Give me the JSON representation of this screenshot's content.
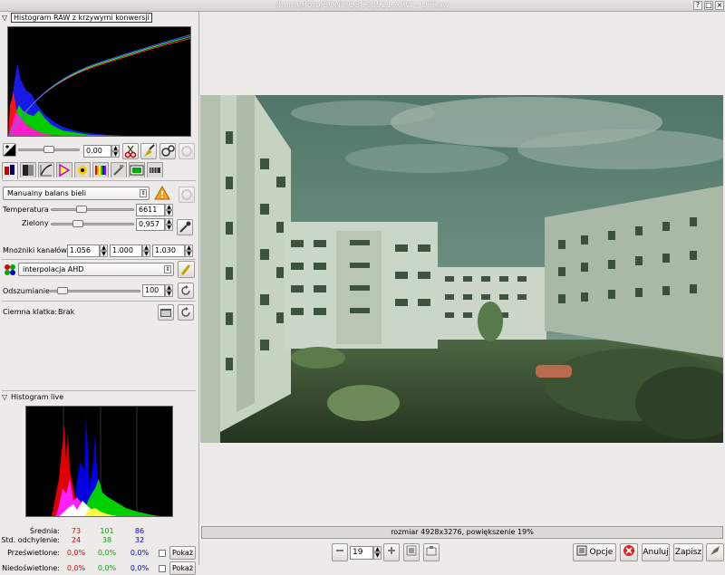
{
  "window": {
    "title": "/home/foto/SONY/DSC00521.ARW - UFRaw",
    "buttons": [
      "?",
      "□",
      "×"
    ]
  },
  "raw_histogram": {
    "title": "Histogram RAW z krzywymi konwersji"
  },
  "exposure": {
    "value": "0.00"
  },
  "white_balance": {
    "mode": "Manualny balans bieli"
  },
  "temperature": {
    "label": "Temperatura",
    "value": "6611"
  },
  "green": {
    "label": "Zielony",
    "value": "0,957"
  },
  "channel_multipliers": {
    "label": "Mnożniki kanałów",
    "values": [
      "1.056",
      "1.000",
      "1.030"
    ]
  },
  "interpolation": {
    "value": "interpolacja AHD"
  },
  "denoise": {
    "label": "Odszumianie",
    "value": "100"
  },
  "dark_frame": {
    "label": "Ciemna klatka:",
    "value": "Brak"
  },
  "live_histogram": {
    "title": "Histogram live",
    "rows": [
      {
        "label": "Średnia:",
        "values": [
          "73",
          "101",
          "86"
        ]
      },
      {
        "label": "Std. odchylenie:",
        "values": [
          "24",
          "38",
          "32"
        ]
      },
      {
        "label": "Prześwietlone:",
        "values": [
          "0,0%",
          "0,0%",
          "0,0%"
        ],
        "button": "Pokaż"
      },
      {
        "label": "Niedoświetlone:",
        "values": [
          "0,0%",
          "0,0%",
          "0,0%"
        ],
        "button": "Pokaż"
      }
    ],
    "colors": {
      "red": "#e00000",
      "green": "#00b000",
      "blue": "#0000e0"
    }
  },
  "status": {
    "text": "rozmiar 4928x3276, powiększenie 19%"
  },
  "zoom": {
    "value": "19"
  },
  "toolbar": {
    "options": "Opcje",
    "cancel": "Anuluj",
    "save": "Zapisz"
  }
}
